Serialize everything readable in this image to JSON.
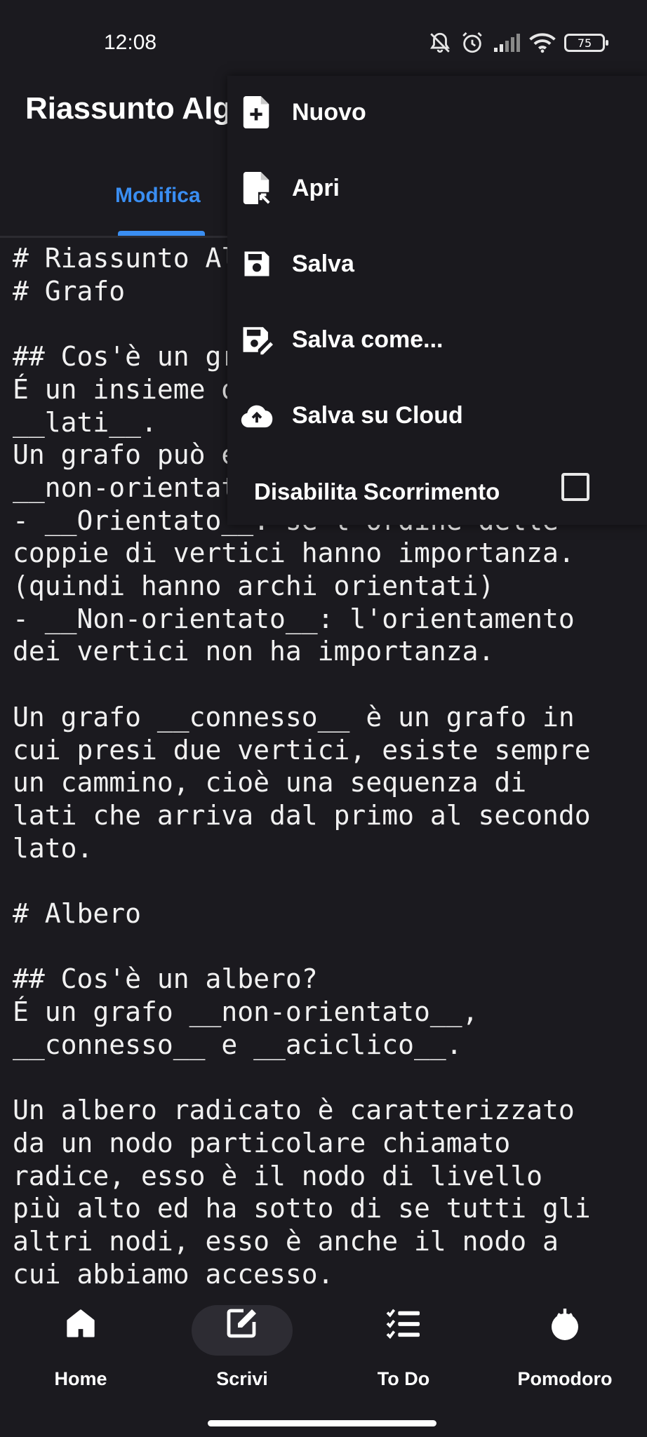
{
  "status_bar": {
    "time": "12:08",
    "battery": "75"
  },
  "app_bar": {
    "title": "Riassunto Algoritmi"
  },
  "tabs": [
    {
      "label": "Modifica",
      "active": true
    }
  ],
  "editor": {
    "content": "# Riassunto Algoritmi\n# Grafo\n\n## Cos'è un grafo?\nÉ un insieme di __vertici__ e di\n__lati__.\nUn grafo può essere __orientato__ o\n__non-orientato__:\n- __Orientato__: se l'ordine delle\ncoppie di vertici hanno importanza.\n(quindi hanno archi orientati)\n- __Non-orientato__: l'orientamento\ndei vertici non ha importanza.\n\nUn grafo __connesso__ è un grafo in\ncui presi due vertici, esiste sempre\nun cammino, cioè una sequenza di\nlati che arriva dal primo al secondo\nlato.\n\n# Albero\n\n## Cos'è un albero?\nÉ un grafo __non-orientato__,\n__connesso__ e __aciclico__.\n\nUn albero radicato è caratterizzato\nda un nodo particolare chiamato\nradice, esso è il nodo di livello\npiù alto ed ha sotto di se tutti gli\naltri nodi, esso è anche il nodo a\ncui abbiamo accesso."
  },
  "menu": {
    "items": [
      {
        "label": "Nuovo",
        "icon": "file-plus-icon"
      },
      {
        "label": "Apri",
        "icon": "file-open-icon"
      },
      {
        "label": "Salva",
        "icon": "save-icon"
      },
      {
        "label": "Salva come...",
        "icon": "save-as-icon"
      },
      {
        "label": "Salva su Cloud",
        "icon": "cloud-upload-icon"
      }
    ],
    "checkbox_label": "Disabilita Scorrimento",
    "checkbox_checked": false
  },
  "bottom_nav": [
    {
      "label": "Home",
      "icon": "home-icon"
    },
    {
      "label": "Scrivi",
      "icon": "edit-icon",
      "active": true
    },
    {
      "label": "To Do",
      "icon": "checklist-icon"
    },
    {
      "label": "Pomodoro",
      "icon": "tomato-icon"
    }
  ],
  "colors": {
    "background": "#1b1a1f",
    "accent": "#3a8ef2",
    "menu_bg": "#1a191e"
  }
}
